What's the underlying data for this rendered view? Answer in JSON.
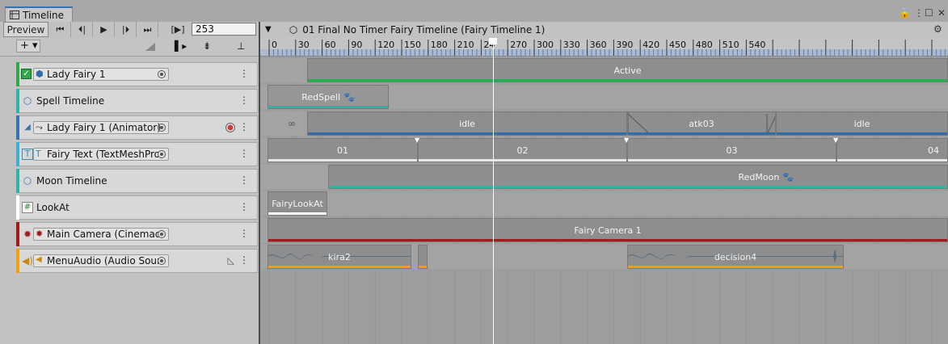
{
  "window": {
    "tab_title": "Timeline"
  },
  "toolbar": {
    "preview_label": "Preview",
    "frame_mode_label": "[▶]",
    "current_frame": "253",
    "breadcrumb": "01 Final No Timer Fairy Timeline (Fairy Timeline 1)"
  },
  "ruler": {
    "ticks": [
      "0",
      "30",
      "60",
      "90",
      "120",
      "150",
      "180",
      "210",
      "24",
      "270",
      "300",
      "330",
      "360",
      "390",
      "420",
      "450",
      "480",
      "510",
      "540"
    ]
  },
  "playhead": {
    "frame": 253
  },
  "tracks": [
    {
      "name": "Lady Fairy 1",
      "kind": "activation",
      "color": "#2fa84a",
      "icon": "cube-icon",
      "has_binding": true,
      "checked": true
    },
    {
      "name": "Spell Timeline",
      "kind": "control",
      "color": "#2fb3a3",
      "icon": "playable-cube-icon"
    },
    {
      "name": "Lady Fairy 1 (Animator)",
      "kind": "animation",
      "color": "#3a72b0",
      "icon": "animator-icon",
      "has_binding": true,
      "record": true
    },
    {
      "name": "Fairy Text (TextMeshPro",
      "kind": "text",
      "color": "#3bb0cf",
      "icon": "text-icon",
      "has_binding": true
    },
    {
      "name": "Moon Timeline",
      "kind": "control",
      "color": "#2fb3a3",
      "icon": "playable-cube-icon"
    },
    {
      "name": "LookAt",
      "kind": "script",
      "color": "#ffffff",
      "icon": "script-icon"
    },
    {
      "name": "Main Camera (Cinemac",
      "kind": "cinemachine",
      "color": "#a41a1a",
      "icon": "camera-icon",
      "has_binding": true
    },
    {
      "name": "MenuAudio (Audio Sour",
      "kind": "audio",
      "color": "#f0a010",
      "icon": "speaker-icon",
      "has_binding": true,
      "curves": true
    }
  ],
  "clips": {
    "activation": [
      "Active"
    ],
    "spell": [
      "RedSpell"
    ],
    "animation": [
      "idle",
      "atk03",
      "idle"
    ],
    "text": [
      "01",
      "02",
      "03",
      "04"
    ],
    "moon": [
      "RedMoon"
    ],
    "lookat": [
      "FairyLookAt"
    ],
    "camera": [
      "Fairy Camera 1"
    ],
    "audio": [
      "kira2",
      "decision4"
    ]
  },
  "colors": {
    "activation": "#2fa84a",
    "control": "#2fb3a3",
    "animation": "#2f6db0",
    "text": "#e8e8e8",
    "cinemachine": "#a41a1a",
    "audio": "#f0a010",
    "lookat": "#ffffff"
  }
}
